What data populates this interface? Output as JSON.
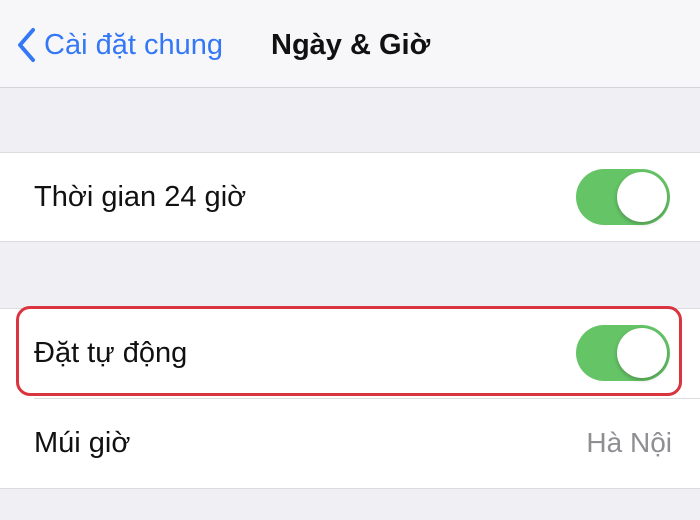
{
  "navbar": {
    "back_label": "Cài đặt chung",
    "back_icon": "chevron-left-icon",
    "title": "Ngày & Giờ"
  },
  "settings": {
    "time_24h": {
      "label": "Thời gian 24 giờ",
      "enabled": true
    },
    "set_automatically": {
      "label": "Đặt tự động",
      "enabled": true
    },
    "time_zone": {
      "label": "Múi giờ",
      "value": "Hà Nội"
    }
  },
  "colors": {
    "accent": "#3478f6",
    "toggle_on": "#65c466",
    "highlight": "#d9343f",
    "secondary_text": "#8e8e93",
    "background": "#efeff4"
  }
}
